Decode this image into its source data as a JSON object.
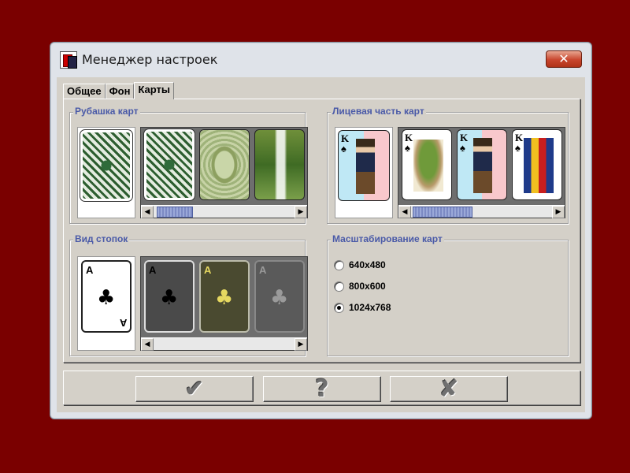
{
  "window": {
    "title": "Менеджер настроек",
    "close_label": "✕"
  },
  "tabs": [
    {
      "label": "Общее",
      "active": false
    },
    {
      "label": "Фон",
      "active": false
    },
    {
      "label": "Карты",
      "active": true
    }
  ],
  "groups": {
    "card_back": {
      "title": "Рубашка карт",
      "options": [
        "green-pattern-back",
        "green-pattern-back",
        "ornate-back",
        "waterfall-back"
      ],
      "scroll_position": 0.1
    },
    "card_face": {
      "title": "Лицевая часть карт",
      "selected": {
        "rank": "K",
        "suit": "♠"
      },
      "options": [
        {
          "rank": "K",
          "suit": "♠"
        },
        {
          "rank": "K",
          "suit": "♠"
        },
        {
          "rank": "K",
          "suit": "♠"
        },
        {
          "rank": "K",
          "suit": "♠"
        }
      ],
      "scroll_position": 0.05
    },
    "piles": {
      "title": "Вид стопок",
      "selected": {
        "rank": "A",
        "suit": "♣"
      },
      "options": [
        {
          "rank": "A",
          "suit": "♣",
          "style": "dark"
        },
        {
          "rank": "A",
          "suit": "♣",
          "style": "gold"
        },
        {
          "rank": "A",
          "suit": "♣",
          "style": "gray"
        }
      ],
      "scroll_position": 0.0
    },
    "scaling": {
      "title": "Масштабирование карт",
      "options": [
        {
          "label": "640x480",
          "checked": false
        },
        {
          "label": "800x600",
          "checked": false
        },
        {
          "label": "1024x768",
          "checked": true
        }
      ]
    }
  },
  "buttons": {
    "ok": "✔",
    "help": "?",
    "cancel": "✘"
  }
}
